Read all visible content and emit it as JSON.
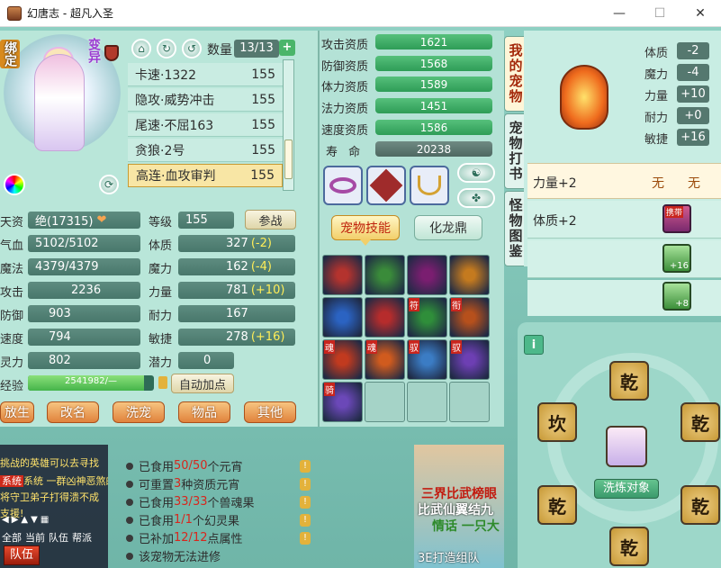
{
  "window": {
    "title": "幻唐志 - 超凡入圣",
    "min": "—",
    "max": "☐",
    "close": "✕"
  },
  "left": {
    "tag_bound": "绑定",
    "tag_mutant": "变异",
    "quantity_label": "数量",
    "quantity_value": "13/13",
    "add": "+",
    "skills": [
      {
        "name": "卡速·1322",
        "value": "155"
      },
      {
        "name": "隐攻·威势冲击",
        "value": "155"
      },
      {
        "name": "尾速·不屈163",
        "value": "155"
      },
      {
        "name": "贪狼·2号",
        "value": "155"
      },
      {
        "name": "高连·血攻审判",
        "value": "155"
      }
    ],
    "talent_label": "天资",
    "talent_value": "绝(17315)",
    "level_label": "等级",
    "level_value": "155",
    "battle_btn": "参战",
    "hp_label": "气血",
    "hp_value": "5102/5102",
    "mp_label": "魔法",
    "mp_value": "4379/4379",
    "atk_label": "攻击",
    "atk_value": "2236",
    "def_label": "防御",
    "def_value": "903",
    "spd_label": "速度",
    "spd_value": "794",
    "spi_label": "灵力",
    "spi_value": "802",
    "exp_label": "经验",
    "exp_value": "2541982/—",
    "con_label": "体质",
    "con_value": "327",
    "con_bonus": "(-2)",
    "mag_label": "魔力",
    "mag_value": "162",
    "mag_bonus": "(-4)",
    "str_label": "力量",
    "str_value": "781",
    "str_bonus": "(+10)",
    "end_label": "耐力",
    "end_value": "167",
    "agi_label": "敏捷",
    "agi_value": "278",
    "agi_bonus": "(+16)",
    "pot_label": "潜力",
    "pot_value": "0",
    "auto_btn": "自动加点",
    "bottom_buttons": [
      "放生",
      "改名",
      "洗宠",
      "物品",
      "其他"
    ]
  },
  "aptitude": {
    "rows": [
      {
        "label": "攻击资质",
        "value": "1621"
      },
      {
        "label": "防御资质",
        "value": "1568"
      },
      {
        "label": "体力资质",
        "value": "1589"
      },
      {
        "label": "法力资质",
        "value": "1451"
      },
      {
        "label": "速度资质",
        "value": "1586"
      }
    ],
    "life_label": "寿 命",
    "life_value": "20238",
    "tab_skills": "宠物技能",
    "tab_dragon": "化龙鼎"
  },
  "skill_grid_marks": [
    "",
    "",
    "",
    "",
    "",
    "",
    "符",
    "衔",
    "魂",
    "魂",
    "驭",
    "驭",
    "骑",
    "",
    "",
    ""
  ],
  "right": {
    "tabs": [
      "我的宠物",
      "宠物打书",
      "怪物图鉴"
    ],
    "attrs": [
      {
        "label": "体质",
        "value": "-2"
      },
      {
        "label": "魔力",
        "value": "-4"
      },
      {
        "label": "力量",
        "value": "+10"
      },
      {
        "label": "耐力",
        "value": "+0"
      },
      {
        "label": "敏捷",
        "value": "+16"
      }
    ],
    "equip_rows": [
      {
        "text": "力量+2",
        "v1": "无",
        "v2": "无"
      },
      {
        "text": "体质+2",
        "v1": "携带",
        "v2": ""
      },
      {
        "text": "",
        "v1": "+16",
        "v2": ""
      },
      {
        "text": "",
        "v1": "+8",
        "v2": ""
      }
    ],
    "info_icon": "i",
    "wash_label": "洗炼对象",
    "runes": [
      "乾",
      "坎",
      "乾",
      "乾",
      "乾",
      "乾"
    ]
  },
  "chat": {
    "lines": [
      "挑战的英雄可以去寻找",
      "系统 一群凶神恶煞的",
      "将守卫弟子打得溃不成",
      "支援!"
    ],
    "controls": [
      "◀",
      "▶",
      "▲",
      "▼",
      "▦"
    ],
    "channels": [
      "全部",
      "当前",
      "队伍",
      "帮派"
    ],
    "team": "队伍"
  },
  "info": {
    "lines": [
      {
        "pre": "已食用",
        "hi": "50/50",
        "post": "个元宵"
      },
      {
        "pre": "可重置",
        "hi": "3",
        "post": "种资质元宵"
      },
      {
        "pre": "已食用",
        "hi": "33/33",
        "post": "个兽魂果"
      },
      {
        "pre": "已食用",
        "hi": "1/1",
        "post": "个幻灵果"
      },
      {
        "pre": "已补加",
        "hi": "12/12",
        "post": "点属性"
      },
      {
        "pre": "该宠物无法进修",
        "hi": "",
        "post": ""
      }
    ],
    "warn": "!"
  },
  "banner": {
    "line1": "三界比武榜眼",
    "line2": "比武仙翼结九",
    "line3": "情话 一只大",
    "line4": "3E打造组队"
  }
}
